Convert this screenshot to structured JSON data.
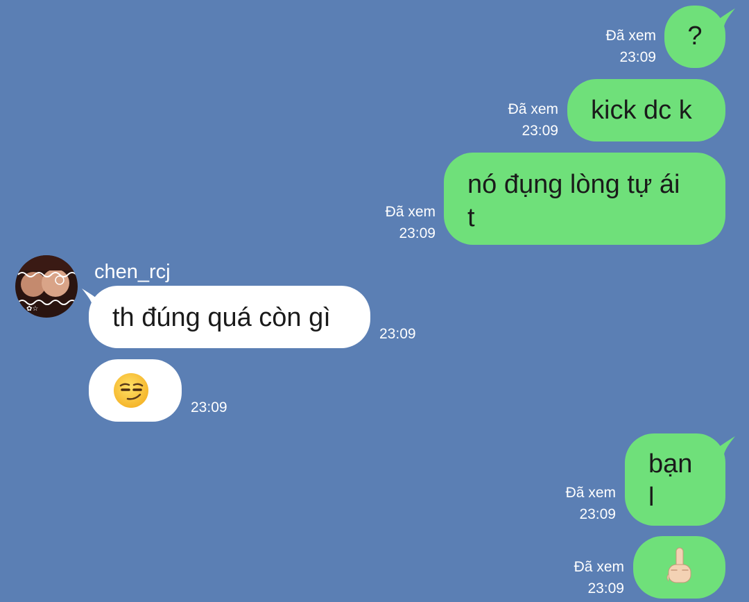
{
  "colors": {
    "background": "#5b7fb4",
    "outgoing_bubble": "#6fe07a",
    "incoming_bubble": "#ffffff",
    "meta_text": "#ffffff"
  },
  "messages": [
    {
      "direction": "out",
      "text": "?",
      "seen": "Đã xem",
      "time": "23:09"
    },
    {
      "direction": "out",
      "text": "kick dc k",
      "seen": "Đã xem",
      "time": "23:09"
    },
    {
      "direction": "out",
      "text_lines": [
        "nó đụng lòng tự ái",
        "t"
      ],
      "seen": "Đã xem",
      "time": "23:09"
    },
    {
      "direction": "in",
      "sender": "chen_rcj",
      "text": "th đúng quá còn gì",
      "time": "23:09"
    },
    {
      "direction": "in",
      "emoji": "smirking-face",
      "time": "23:09"
    },
    {
      "direction": "out",
      "text_lines": [
        "bạn",
        "l"
      ],
      "seen": "Đã xem",
      "time": "23:09"
    },
    {
      "direction": "out",
      "emoji": "middle-finger",
      "seen": "Đã xem",
      "time": "23:09"
    }
  ]
}
